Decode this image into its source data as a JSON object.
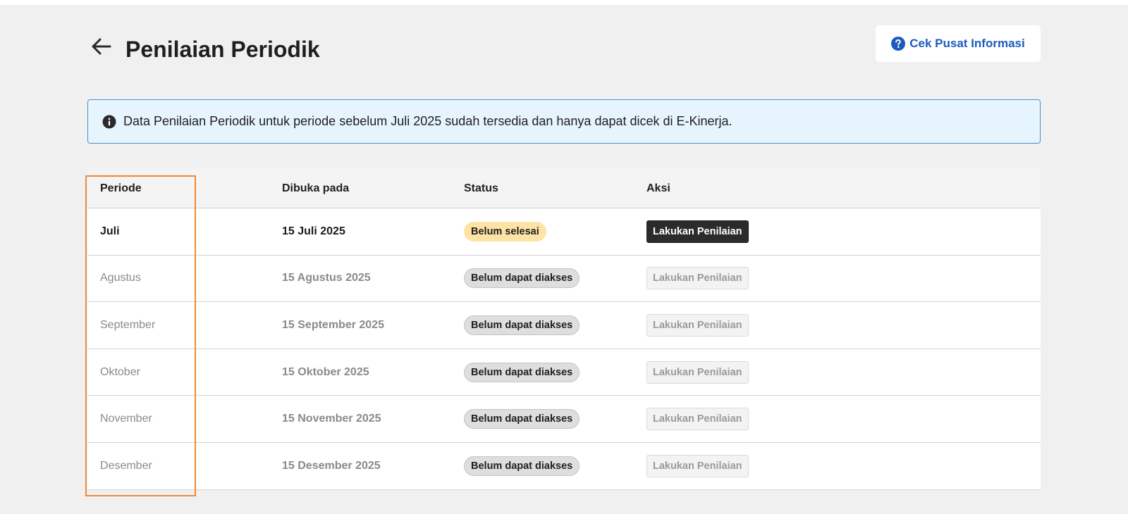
{
  "page": {
    "title": "Penilaian Periodik",
    "back_icon": "arrow-left-icon",
    "help_button": {
      "label": "Cek Pusat Informasi",
      "icon": "question-circle-icon"
    }
  },
  "alert": {
    "icon": "info-icon",
    "text": "Data Penilaian Periodik untuk periode sebelum Juli 2025 sudah tersedia dan hanya dapat dicek di E-Kinerja."
  },
  "table": {
    "headers": {
      "period": "Periode",
      "opened": "Dibuka pada",
      "status": "Status",
      "action": "Aksi"
    },
    "rows": [
      {
        "period": "Juli",
        "opened": "15 Juli 2025",
        "status": "Belum selesai",
        "action": "Lakukan Penilaian",
        "active": true
      },
      {
        "period": "Agustus",
        "opened": "15 Agustus 2025",
        "status": "Belum dapat diakses",
        "action": "Lakukan Penilaian",
        "active": false
      },
      {
        "period": "September",
        "opened": "15 September 2025",
        "status": "Belum dapat diakses",
        "action": "Lakukan Penilaian",
        "active": false
      },
      {
        "period": "Oktober",
        "opened": "15 Oktober 2025",
        "status": "Belum dapat diakses",
        "action": "Lakukan Penilaian",
        "active": false
      },
      {
        "period": "November",
        "opened": "15 November 2025",
        "status": "Belum dapat diakses",
        "action": "Lakukan Penilaian",
        "active": false
      },
      {
        "period": "Desember",
        "opened": "15 Desember 2025",
        "status": "Belum dapat diakses",
        "action": "Lakukan Penilaian",
        "active": false
      }
    ]
  },
  "colors": {
    "highlight_outline": "#ef8a36",
    "link_blue": "#1a5bbd",
    "alert_bg": "#e6f4fd",
    "warning_badge": "#fde3a6",
    "primary_button": "#2b2b2b"
  }
}
